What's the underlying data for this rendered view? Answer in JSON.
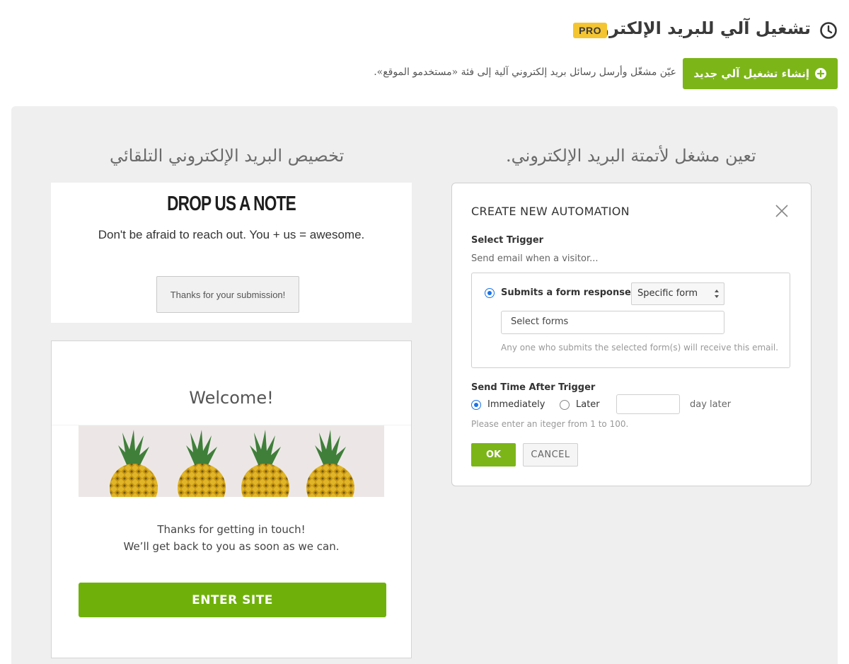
{
  "header": {
    "title": "تشغيل آلي للبريد الإلكتروني",
    "badge": "PRO",
    "icon": "clock-icon"
  },
  "subheader": {
    "create_button_label": "إنشاء تشغيل آلي جديد",
    "create_button_icon": "plus-circle-icon",
    "description": "عيّن مشغّل وأرسل رسائل بريد إلكتروني آلية إلى فئة «مستخدمو الموقع»."
  },
  "columns": {
    "left_title": "تخصيص البريد الإلكتروني التلقائي",
    "right_title": "تعين مشغل لأتمتة البريد الإلكتروني."
  },
  "form_preview": {
    "title": "DROP US A NOTE",
    "subtitle": "Don't be afraid to reach out. You + us = awesome.",
    "submission_message": "Thanks for your submission!"
  },
  "email_preview": {
    "heading": "Welcome!",
    "image": "pineapples-image",
    "message_line1": "Thanks for getting in touch!",
    "message_line2": "We’ll get back to you as soon as we can.",
    "button_label": "ENTER SITE"
  },
  "dialog": {
    "title": "CREATE NEW AUTOMATION",
    "select_trigger_label": "Select Trigger",
    "trigger_desc": "Send email when a visitor...",
    "trigger_option": "Submits a form response to",
    "trigger_select_value": "Specific form",
    "forms_placeholder": "Select forms",
    "forms_hint": "Any one who submits the selected form(s) will receive this email.",
    "send_time_label": "Send Time After Trigger",
    "immediately_label": "Immediately",
    "later_label": "Later",
    "day_later_label": "day later",
    "days_value": "",
    "days_hint": "Please enter an iteger  from 1 to 100.",
    "ok_label": "OK",
    "cancel_label": "CANCEL"
  },
  "colors": {
    "accent_green": "#7cb518",
    "pro_badge": "#f4c531",
    "radio_blue": "#1a73e8",
    "panel_bg": "#efefef"
  }
}
